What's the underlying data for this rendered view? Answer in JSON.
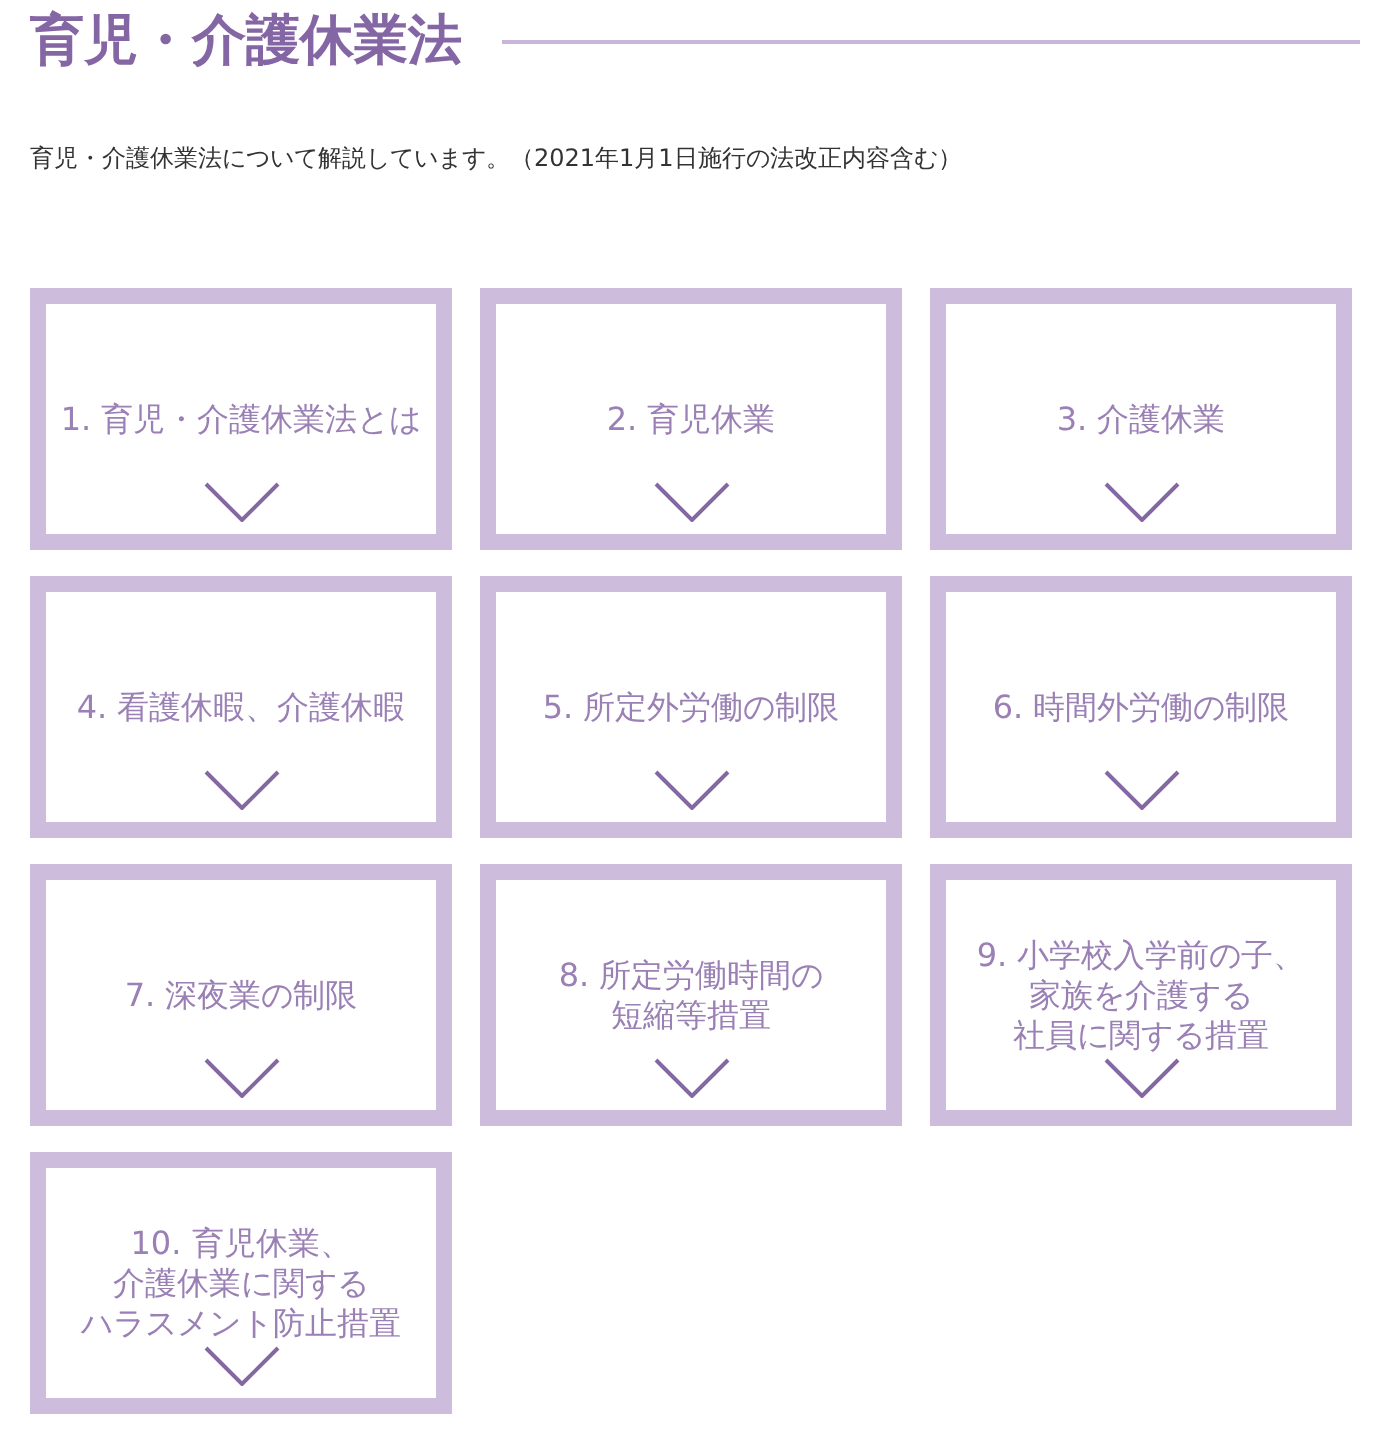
{
  "header": {
    "title": "育児・介護休業法",
    "description": "育児・介護休業法について解説しています。（2021年1月1日施行の法改正内容含む）"
  },
  "topics": [
    {
      "lines": [
        "1. 育児・介護休業法とは"
      ]
    },
    {
      "lines": [
        "2. 育児休業"
      ]
    },
    {
      "lines": [
        "3. 介護休業"
      ]
    },
    {
      "lines": [
        "4. 看護休暇、介護休暇"
      ]
    },
    {
      "lines": [
        "5. 所定外労働の制限"
      ]
    },
    {
      "lines": [
        "6. 時間外労働の制限"
      ]
    },
    {
      "lines": [
        "7. 深夜業の制限"
      ]
    },
    {
      "lines": [
        "8. 所定労働時間の",
        "短縮等措置"
      ]
    },
    {
      "lines": [
        "9. 小学校入学前の子、",
        "家族を介護する",
        "社員に関する措置"
      ]
    },
    {
      "lines": [
        "10. 育児休業、",
        "介護休業に関する",
        "ハラスメント防止措置"
      ]
    }
  ]
}
